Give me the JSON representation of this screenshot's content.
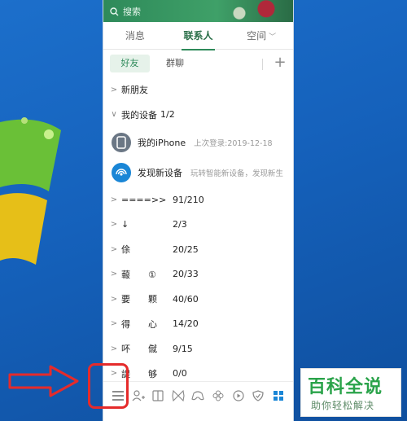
{
  "search": {
    "label": "搜索"
  },
  "tabs": [
    {
      "label": "消息"
    },
    {
      "label": "联系人"
    },
    {
      "label": "空间"
    }
  ],
  "subtabs": {
    "friends": "好友",
    "groups": "群聊",
    "add": "+"
  },
  "list": {
    "new_friends": "新朋友",
    "my_devices": {
      "name": "我的设备",
      "count": "1/2"
    },
    "devices": [
      {
        "name": "我的iPhone",
        "sub": "上次登录:2019-12-18"
      },
      {
        "name": "发现新设备",
        "sub": "玩转智能新设备，发现新生"
      }
    ],
    "groups": [
      {
        "name": "====>>",
        "count": "91/210"
      },
      {
        "name": "↓",
        "count": "2/3"
      },
      {
        "name": "俆",
        "count": "20/25"
      },
      {
        "name": "蕔　　①",
        "count": "20/33"
      },
      {
        "name": "要　　颗",
        "count": "40/60"
      },
      {
        "name": "得　　心",
        "count": "14/20"
      },
      {
        "name": "吥　　僦",
        "count": "9/15"
      },
      {
        "name": "諟　　够",
        "count": "0/0"
      }
    ]
  },
  "bottom_icons": [
    "menu-icon",
    "add-friend-icon",
    "contacts-icon",
    "butterfly-icon",
    "game-icon",
    "flower-icon",
    "video-icon",
    "shield-icon",
    "apps-icon"
  ],
  "watermark": {
    "title": "百科全说",
    "subtitle": "助你轻松解决"
  },
  "colors": {
    "accent": "#2e8a5a",
    "highlight": "#e52b2b",
    "desktop": "#1561bb"
  }
}
